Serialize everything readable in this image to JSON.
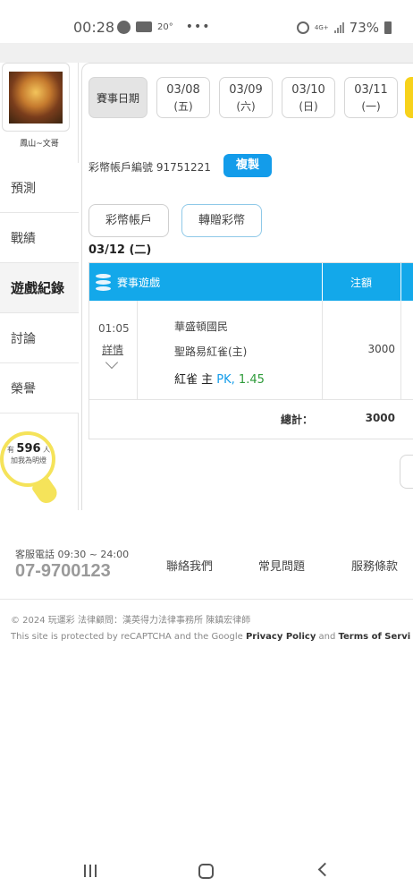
{
  "status_bar": {
    "time": "00:28",
    "temperature": "20°",
    "more": "•••",
    "network": "4G+",
    "battery": "73%"
  },
  "sidebar": {
    "avatar_name": "鳳山~文哥",
    "items": [
      {
        "label": "預測"
      },
      {
        "label": "戰績"
      },
      {
        "label": "遊戲紀錄",
        "active": true
      },
      {
        "label": "討論"
      },
      {
        "label": "榮譽"
      }
    ],
    "bulb": {
      "prefix": "有",
      "count": "596",
      "suffix": "人",
      "line2": "加我為明燈"
    }
  },
  "date_tabs": {
    "label": "賽事日期",
    "dates": [
      {
        "date": "03/08",
        "weekday": "(五)"
      },
      {
        "date": "03/09",
        "weekday": "(六)"
      },
      {
        "date": "03/10",
        "weekday": "(日)"
      },
      {
        "date": "03/11",
        "weekday": "(一)"
      }
    ]
  },
  "account": {
    "label": "彩幣帳戶編號",
    "number": "91751221",
    "copy_label": "複製"
  },
  "buttons": {
    "wallet": "彩幣帳戶",
    "transfer": "轉贈彩幣"
  },
  "current_date": "03/12 (二)",
  "table": {
    "header_game": "賽事遊戲",
    "header_amount": "注額",
    "row": {
      "time": "01:05",
      "detail": "詳情",
      "team1": "華盛頓國民",
      "team2": "聖路易紅雀(主)",
      "pick_team": "紅雀 主",
      "pick_type": "PK,",
      "pick_odds": "1.45",
      "amount": "3000"
    },
    "total_label": "總計：",
    "total_amount": "3000"
  },
  "footer": {
    "cs_label": "客服電話 09:30 ~ 24:00",
    "cs_phone": "07-9700123",
    "links": [
      "聯絡我們",
      "常見問題",
      "服務條款"
    ],
    "copyright": "© 2024 玩運彩 法律顧問：漢英得力法律事務所 陳鎮宏律師",
    "recaptcha_prefix": "This site is protected by reCAPTCHA and the Google ",
    "privacy": "Privacy Policy",
    "and": " and ",
    "terms": "Terms of Servi"
  },
  "colors": {
    "accent_blue": "#139cea",
    "odds_green": "#2e9b3a",
    "bulb_yellow": "#f5e35a",
    "date_more_yellow": "#f7d21b"
  }
}
